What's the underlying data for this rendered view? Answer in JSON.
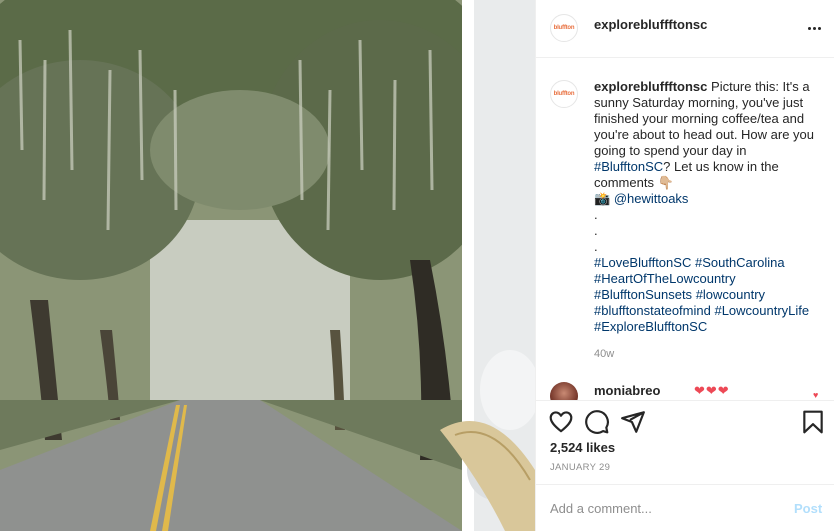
{
  "post": {
    "username": "explorebluffftonsc",
    "avatar_text": "bluffton",
    "photo_alt": "Oak-lined street with Spanish moss in Bluffton SC",
    "caption": {
      "username": "explorebluffftonsc",
      "line1": "Picture this: It's a",
      "line2": "sunny Saturday morning, you've just",
      "line3": "finished your morning coffee/tea and",
      "line4": "you're about to head out. How are you",
      "line5": "going to spend your day in",
      "tag_bluffton": "#BlufftonSC",
      "line6_rest": "? Let us know in the",
      "line7": "comments 👇🏼",
      "camera": "📸",
      "mention": "@hewittoaks",
      "dot": ".",
      "hashtags": [
        "#LoveBlufftonSC",
        "#SouthCarolina",
        "#HeartOfTheLowcountry",
        "#BlufftonSunsets",
        "#lowcountry",
        "#blufftonstateofmind",
        "#LowcountryLife",
        "#ExploreBlufftonSC"
      ]
    },
    "time_ago": "40w",
    "comment": {
      "username": "moniabreo",
      "text": "❤❤❤",
      "like_icon": "heart-icon-small"
    },
    "likes": "2,524 likes",
    "date": "JANUARY 29",
    "add_comment_placeholder": "Add a comment...",
    "post_label": "Post"
  },
  "colors": {
    "hashtag": "#00376b",
    "muted": "#8e8e8e",
    "post_disabled": "#b2dffc",
    "heart_red": "#ed4956"
  },
  "icons": {
    "more": "more-options-icon",
    "like": "heart-icon",
    "comment": "comment-icon",
    "share": "paper-plane-icon",
    "save": "bookmark-icon"
  }
}
